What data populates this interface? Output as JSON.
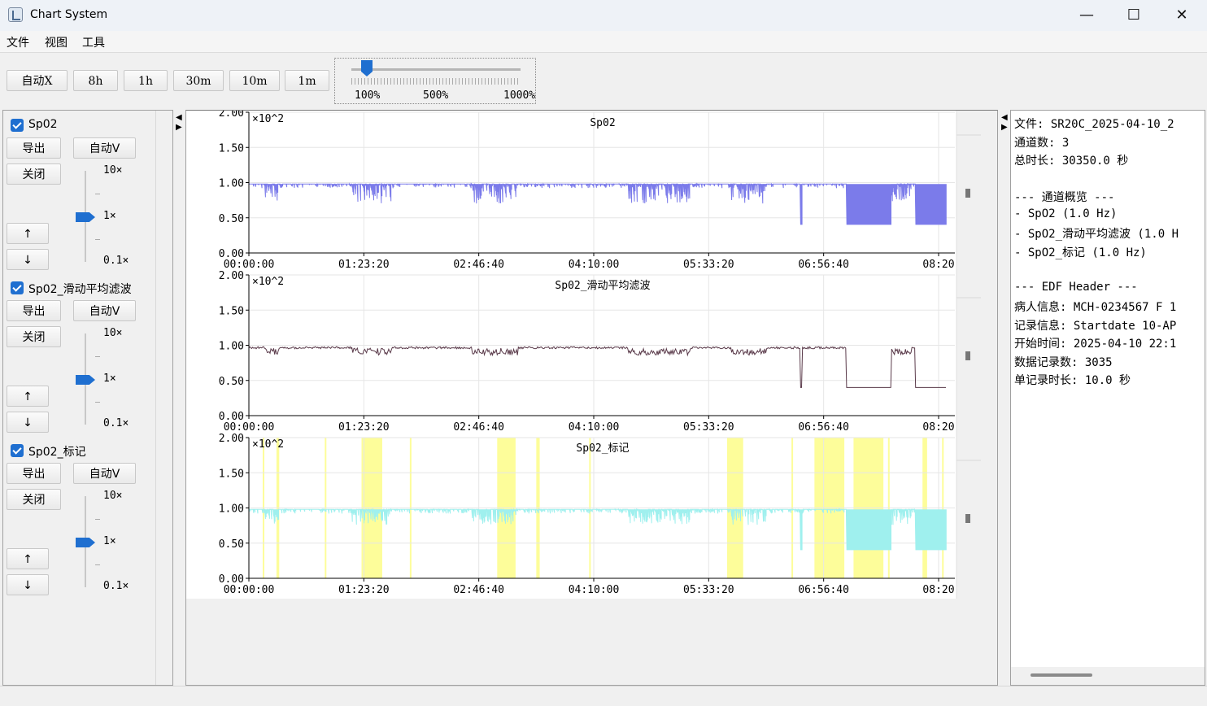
{
  "window": {
    "title": "Chart System",
    "controls": {
      "minimize": "—",
      "maximize": "☐",
      "close": "✕"
    }
  },
  "menu": [
    "文件",
    "视图",
    "工具"
  ],
  "toolbar": {
    "buttons": [
      "自动X",
      "8h",
      "1h",
      "30m",
      "10m",
      "1m"
    ],
    "zoom": {
      "labels": [
        "100%",
        "500%",
        "1000%"
      ],
      "value_percent": 100
    }
  },
  "channels": [
    {
      "name": "Sp02",
      "checked": true,
      "export": "导出",
      "auto_v": "自动V",
      "close": "关闭",
      "up": "↑",
      "down": "↓",
      "scale_labels": [
        "10×",
        "1×",
        "0.1×"
      ],
      "scale_value": "1×"
    },
    {
      "name": "Sp02_滑动平均滤波",
      "checked": true,
      "export": "导出",
      "auto_v": "自动V",
      "close": "关闭",
      "up": "↑",
      "down": "↓",
      "scale_labels": [
        "10×",
        "1×",
        "0.1×"
      ],
      "scale_value": "1×"
    },
    {
      "name": "Sp02_标记",
      "checked": true,
      "export": "导出",
      "auto_v": "自动V",
      "close": "关闭",
      "up": "↑",
      "down": "↓",
      "scale_labels": [
        "10×",
        "1×",
        "0.1×"
      ],
      "scale_value": "1×"
    }
  ],
  "chart_data": [
    {
      "type": "line",
      "title": "Sp02",
      "multiplier": "×10^2",
      "y_ticks": [
        "0.00",
        "0.50",
        "1.00",
        "1.50",
        "2.00"
      ],
      "x_ticks": [
        "00:00:00",
        "01:23:20",
        "02:46:40",
        "04:10:00",
        "05:33:20",
        "06:56:40",
        "08:20"
      ],
      "ylim": [
        0,
        2.0
      ],
      "xlim_seconds": [
        0,
        30350
      ],
      "series": [
        {
          "color": "#7b7bea",
          "baseline": 0.98
        }
      ],
      "low_segments": [
        {
          "from": "06:56:40",
          "to": "07:25",
          "value": 0.4
        },
        {
          "from": "08:07",
          "to": "08:25",
          "value": 0.4
        }
      ]
    },
    {
      "type": "line",
      "title": "Sp02_滑动平均滤波",
      "multiplier": "×10^2",
      "y_ticks": [
        "0.00",
        "0.50",
        "1.00",
        "1.50",
        "2.00"
      ],
      "x_ticks": [
        "00:00:00",
        "01:23:20",
        "02:46:40",
        "04:10:00",
        "05:33:20",
        "06:56:40",
        "08:20"
      ],
      "ylim": [
        0,
        2.0
      ],
      "xlim_seconds": [
        0,
        30350
      ],
      "series": [
        {
          "color": "#5a3a4a",
          "baseline": 0.98
        }
      ],
      "low_segments": [
        {
          "from": "06:56:40",
          "to": "07:25",
          "value": 0.4
        },
        {
          "from": "08:07",
          "to": "08:25",
          "value": 0.4
        }
      ]
    },
    {
      "type": "line",
      "title": "Sp02_标记",
      "multiplier": "×10^2",
      "y_ticks": [
        "0.00",
        "0.50",
        "1.00",
        "1.50",
        "2.00"
      ],
      "x_ticks": [
        "00:00:00",
        "01:23:20",
        "02:46:40",
        "04:10:00",
        "05:33:20",
        "06:56:40",
        "08:20"
      ],
      "ylim": [
        0,
        2.0
      ],
      "xlim_seconds": [
        0,
        30350
      ],
      "series": [
        {
          "color": "#9ff0ee",
          "baseline": 0.98
        }
      ],
      "highlight_color": "#fdfd9a",
      "low_segments": [
        {
          "from": "06:56:40",
          "to": "07:25",
          "value": 0.4
        },
        {
          "from": "08:07",
          "to": "08:25",
          "value": 0.4
        }
      ]
    }
  ],
  "info": {
    "lines": [
      "文件: SR20C_2025-04-10_2",
      "通道数: 3",
      "总时长: 30350.0 秒",
      "",
      "--- 通道概览 ---",
      "- SpO2 (1.0 Hz)",
      "- SpO2_滑动平均滤波 (1.0 H",
      "- SpO2_标记 (1.0 Hz)",
      "",
      "--- EDF Header ---",
      "病人信息: MCH-0234567 F 1",
      "记录信息: Startdate 10-AP",
      "开始时间: 2025-04-10 22:1",
      "数据记录数: 3035",
      "单记录时长: 10.0 秒"
    ]
  }
}
